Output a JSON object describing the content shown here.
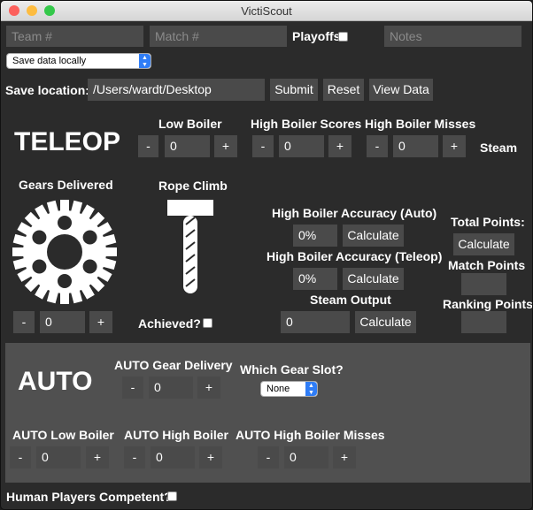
{
  "window": {
    "title": "VictiScout"
  },
  "top": {
    "team_placeholder": "Team #",
    "match_placeholder": "Match #",
    "playoffs_label": "Playoffs",
    "notes_placeholder": "Notes",
    "save_mode": "Save data locally"
  },
  "save": {
    "location_label": "Save location:",
    "location_value": "/Users/wardt/Desktop",
    "submit": "Submit",
    "reset": "Reset",
    "view_data": "View Data"
  },
  "teleop": {
    "heading": "TELEOP",
    "low_boiler_label": "Low Boiler",
    "low_boiler_value": "0",
    "high_scores_label": "High Boiler Scores",
    "high_scores_value": "0",
    "high_misses_label": "High Boiler Misses",
    "high_misses_value": "0",
    "steam_label": "Steam",
    "gears_label": "Gears Delivered",
    "gears_value": "0",
    "rope_label": "Rope Climb",
    "achieved_label": "Achieved?",
    "acc_auto_label": "High Boiler Accuracy (Auto)",
    "acc_auto_value": "0%",
    "acc_teleop_label": "High Boiler Accuracy (Teleop)",
    "acc_teleop_value": "0%",
    "steam_output_label": "Steam Output",
    "steam_output_value": "0",
    "calculate": "Calculate",
    "total_points_label": "Total Points:",
    "match_points_label": "Match Points",
    "ranking_points_label": "Ranking Points",
    "minus": "-",
    "plus": "+"
  },
  "auto": {
    "heading": "AUTO",
    "gear_delivery_label": "AUTO Gear Delivery",
    "gear_delivery_value": "0",
    "gear_slot_label": "Which Gear Slot?",
    "gear_slot_value": "None",
    "low_boiler_label": "AUTO Low Boiler",
    "low_boiler_value": "0",
    "high_boiler_label": "AUTO High Boiler",
    "high_boiler_value": "0",
    "high_misses_label": "AUTO High Boiler Misses",
    "high_misses_value": "0"
  },
  "human_players_label": "Human Players Competent?",
  "colors": {
    "close": "#fc605c",
    "minimize": "#fdbc40",
    "zoom": "#34c84a",
    "select_accent": "#2f7df6"
  }
}
